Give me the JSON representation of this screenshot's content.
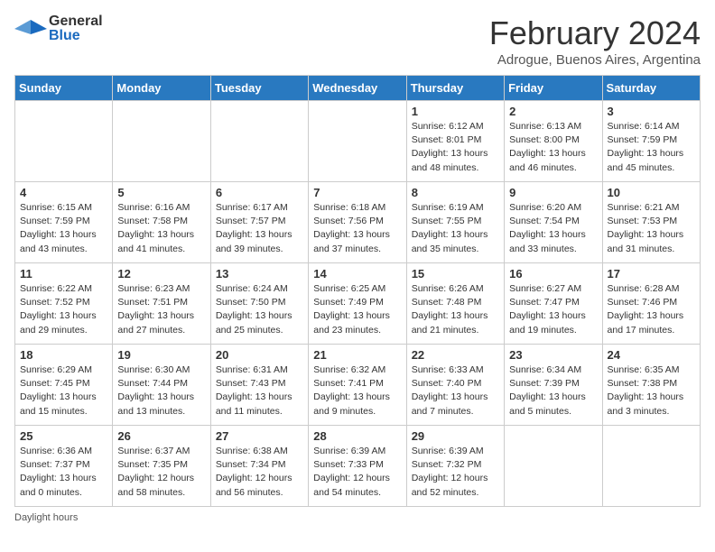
{
  "header": {
    "logo_general": "General",
    "logo_blue": "Blue",
    "month_title": "February 2024",
    "location": "Adrogue, Buenos Aires, Argentina"
  },
  "days_of_week": [
    "Sunday",
    "Monday",
    "Tuesday",
    "Wednesday",
    "Thursday",
    "Friday",
    "Saturday"
  ],
  "weeks": [
    [
      {
        "day": "",
        "info": ""
      },
      {
        "day": "",
        "info": ""
      },
      {
        "day": "",
        "info": ""
      },
      {
        "day": "",
        "info": ""
      },
      {
        "day": "1",
        "info": "Sunrise: 6:12 AM\nSunset: 8:01 PM\nDaylight: 13 hours\nand 48 minutes."
      },
      {
        "day": "2",
        "info": "Sunrise: 6:13 AM\nSunset: 8:00 PM\nDaylight: 13 hours\nand 46 minutes."
      },
      {
        "day": "3",
        "info": "Sunrise: 6:14 AM\nSunset: 7:59 PM\nDaylight: 13 hours\nand 45 minutes."
      }
    ],
    [
      {
        "day": "4",
        "info": "Sunrise: 6:15 AM\nSunset: 7:59 PM\nDaylight: 13 hours\nand 43 minutes."
      },
      {
        "day": "5",
        "info": "Sunrise: 6:16 AM\nSunset: 7:58 PM\nDaylight: 13 hours\nand 41 minutes."
      },
      {
        "day": "6",
        "info": "Sunrise: 6:17 AM\nSunset: 7:57 PM\nDaylight: 13 hours\nand 39 minutes."
      },
      {
        "day": "7",
        "info": "Sunrise: 6:18 AM\nSunset: 7:56 PM\nDaylight: 13 hours\nand 37 minutes."
      },
      {
        "day": "8",
        "info": "Sunrise: 6:19 AM\nSunset: 7:55 PM\nDaylight: 13 hours\nand 35 minutes."
      },
      {
        "day": "9",
        "info": "Sunrise: 6:20 AM\nSunset: 7:54 PM\nDaylight: 13 hours\nand 33 minutes."
      },
      {
        "day": "10",
        "info": "Sunrise: 6:21 AM\nSunset: 7:53 PM\nDaylight: 13 hours\nand 31 minutes."
      }
    ],
    [
      {
        "day": "11",
        "info": "Sunrise: 6:22 AM\nSunset: 7:52 PM\nDaylight: 13 hours\nand 29 minutes."
      },
      {
        "day": "12",
        "info": "Sunrise: 6:23 AM\nSunset: 7:51 PM\nDaylight: 13 hours\nand 27 minutes."
      },
      {
        "day": "13",
        "info": "Sunrise: 6:24 AM\nSunset: 7:50 PM\nDaylight: 13 hours\nand 25 minutes."
      },
      {
        "day": "14",
        "info": "Sunrise: 6:25 AM\nSunset: 7:49 PM\nDaylight: 13 hours\nand 23 minutes."
      },
      {
        "day": "15",
        "info": "Sunrise: 6:26 AM\nSunset: 7:48 PM\nDaylight: 13 hours\nand 21 minutes."
      },
      {
        "day": "16",
        "info": "Sunrise: 6:27 AM\nSunset: 7:47 PM\nDaylight: 13 hours\nand 19 minutes."
      },
      {
        "day": "17",
        "info": "Sunrise: 6:28 AM\nSunset: 7:46 PM\nDaylight: 13 hours\nand 17 minutes."
      }
    ],
    [
      {
        "day": "18",
        "info": "Sunrise: 6:29 AM\nSunset: 7:45 PM\nDaylight: 13 hours\nand 15 minutes."
      },
      {
        "day": "19",
        "info": "Sunrise: 6:30 AM\nSunset: 7:44 PM\nDaylight: 13 hours\nand 13 minutes."
      },
      {
        "day": "20",
        "info": "Sunrise: 6:31 AM\nSunset: 7:43 PM\nDaylight: 13 hours\nand 11 minutes."
      },
      {
        "day": "21",
        "info": "Sunrise: 6:32 AM\nSunset: 7:41 PM\nDaylight: 13 hours\nand 9 minutes."
      },
      {
        "day": "22",
        "info": "Sunrise: 6:33 AM\nSunset: 7:40 PM\nDaylight: 13 hours\nand 7 minutes."
      },
      {
        "day": "23",
        "info": "Sunrise: 6:34 AM\nSunset: 7:39 PM\nDaylight: 13 hours\nand 5 minutes."
      },
      {
        "day": "24",
        "info": "Sunrise: 6:35 AM\nSunset: 7:38 PM\nDaylight: 13 hours\nand 3 minutes."
      }
    ],
    [
      {
        "day": "25",
        "info": "Sunrise: 6:36 AM\nSunset: 7:37 PM\nDaylight: 13 hours\nand 0 minutes."
      },
      {
        "day": "26",
        "info": "Sunrise: 6:37 AM\nSunset: 7:35 PM\nDaylight: 12 hours\nand 58 minutes."
      },
      {
        "day": "27",
        "info": "Sunrise: 6:38 AM\nSunset: 7:34 PM\nDaylight: 12 hours\nand 56 minutes."
      },
      {
        "day": "28",
        "info": "Sunrise: 6:39 AM\nSunset: 7:33 PM\nDaylight: 12 hours\nand 54 minutes."
      },
      {
        "day": "29",
        "info": "Sunrise: 6:39 AM\nSunset: 7:32 PM\nDaylight: 12 hours\nand 52 minutes."
      },
      {
        "day": "",
        "info": ""
      },
      {
        "day": "",
        "info": ""
      }
    ]
  ],
  "footer": {
    "daylight_label": "Daylight hours"
  }
}
